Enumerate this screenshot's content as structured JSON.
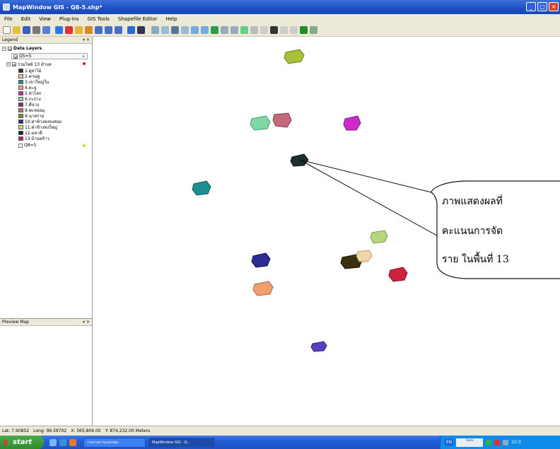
{
  "window": {
    "title": "MapWindow GIS  - Q8-5.shp*",
    "buttons": [
      "_",
      "□",
      "×"
    ]
  },
  "menu": [
    "File",
    "Edit",
    "View",
    "Plug-ins",
    "GIS Tools",
    "Shapefile Editor",
    "Help"
  ],
  "legend": {
    "title": "Legend",
    "pin": "▾ ✕",
    "group_label": "Data Layers",
    "layers": [
      {
        "label": "Q5=5",
        "checked": true
      },
      {
        "label": "รวมไฟล์ 13 ตำบล",
        "checked": true,
        "expanded": true
      }
    ],
    "classes": [
      {
        "label": "1.ดูยาไม้",
        "color": "#3a2a14"
      },
      {
        "label": "2.ควนคู",
        "color": "#e8c89a"
      },
      {
        "label": "3.เขาใหญ่ใน",
        "color": "#1b8f8f"
      },
      {
        "label": "4.ตะจู",
        "color": "#f0a27a"
      },
      {
        "label": "5.ท่าไลก",
        "color": "#c426c4"
      },
      {
        "label": "6.กะปาง",
        "color": "#8fe0b0"
      },
      {
        "label": "7.ตีนาง",
        "color": "#7a2c7a"
      },
      {
        "label": "8.พะหลอมุ",
        "color": "#c26a7a"
      },
      {
        "label": "9.นาทราย",
        "color": "#8a8a2a"
      },
      {
        "label": "10.ท่าช้างท่งหงส่อม",
        "color": "#2a2a88"
      },
      {
        "label": "11.ท่าช้างท่งใหญ่",
        "color": "#c7e07a"
      },
      {
        "label": "12.มหาดี",
        "color": "#162424"
      },
      {
        "label": "13.บ้านพร้าว",
        "color": "#d0223e"
      }
    ],
    "extra_layer": "Q8=5",
    "marker_colors": {
      "red": "#dd1111",
      "yellow": "#d8d81a"
    }
  },
  "preview": {
    "title": "Preview Map",
    "pin": "▾ ✕"
  },
  "callout": {
    "lines": [
      "ภาพแสดงผลที่",
      "คะแนนการจัด",
      "ราย ในพื้นที่ 13"
    ]
  },
  "map_shapes": [
    {
      "id": "shape-11-top",
      "color": "#a5c23a"
    },
    {
      "id": "shape-6",
      "color": "#7fd9a6"
    },
    {
      "id": "shape-8",
      "color": "#c26a7a"
    },
    {
      "id": "shape-5",
      "color": "#cc2acc"
    },
    {
      "id": "shape-12",
      "color": "#1f2f30"
    },
    {
      "id": "shape-3",
      "color": "#1b8f8f"
    },
    {
      "id": "shape-11",
      "color": "#b8d680"
    },
    {
      "id": "shape-1",
      "color": "#3c3010"
    },
    {
      "id": "shape-2",
      "color": "#f1d7a8"
    },
    {
      "id": "shape-10",
      "color": "#2d2a90"
    },
    {
      "id": "shape-13",
      "color": "#d0223e"
    },
    {
      "id": "shape-4",
      "color": "#ef9e6e"
    },
    {
      "id": "shape-7",
      "color": "#5a3fc0"
    }
  ],
  "status": {
    "lat": "Lat: 7.90852",
    "long": "Long: 99.59702",
    "x": "X: 565,806.00",
    "y": "Y: 874,232.00 Meters"
  },
  "taskbar": {
    "start": "start",
    "tasks": [
      "รายงานการแบ่งกลุ่ม...",
      "MapWindow GIS - Q..."
    ],
    "lang": "EN",
    "tray_logo": "itioto",
    "clock": "22:0"
  }
}
